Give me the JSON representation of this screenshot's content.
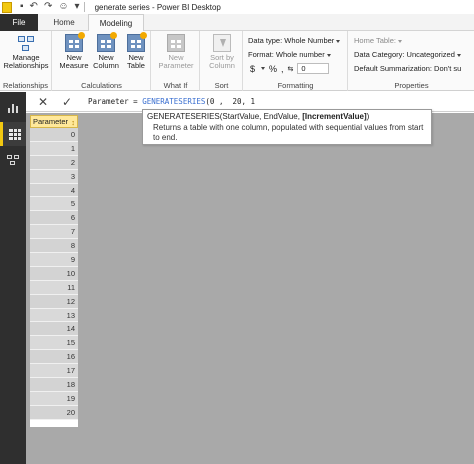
{
  "window": {
    "title": "generate series - Power BI Desktop"
  },
  "tabs": {
    "file": "File",
    "home": "Home",
    "modeling": "Modeling"
  },
  "ribbon": {
    "relationships": {
      "button": "Manage\nRelationships",
      "group": "Relationships"
    },
    "calculations": {
      "new_measure": "New\nMeasure",
      "new_column": "New\nColumn",
      "new_table": "New\nTable",
      "group": "Calculations"
    },
    "whatif": {
      "new_parameter": "New\nParameter",
      "group": "What If"
    },
    "sort": {
      "sort_by_column": "Sort by\nColumn",
      "group": "Sort"
    },
    "formatting": {
      "data_type": "Data type: Whole Number",
      "format": "Format: Whole number",
      "currency": "$",
      "percent": "%",
      "comma": ",",
      "decimals": "0",
      "group": "Formatting"
    },
    "properties": {
      "home_table": "Home Table:",
      "data_category": "Data Category: Uncategorized",
      "default_summarization": "Default Summarization: Don't su",
      "group": "Properties"
    }
  },
  "formula_bar": {
    "prefix": "Parameter = ",
    "function": "GENERATESERIES",
    "args": "(0 ,  20, 1"
  },
  "tooltip": {
    "signature_start": "GENERATESERIES(StartValue, EndValue, ",
    "signature_bold": "[IncrementValue]",
    "signature_end": ")",
    "description": "Returns a table with one column, populated with sequential values from start to end."
  },
  "table": {
    "column": "Parameter",
    "values": [
      "0",
      "1",
      "2",
      "3",
      "4",
      "5",
      "6",
      "7",
      "8",
      "9",
      "10",
      "11",
      "12",
      "13",
      "14",
      "15",
      "16",
      "17",
      "18",
      "19",
      "20"
    ]
  },
  "colors": {
    "accent": "#f2c811",
    "rail": "#2f2f2f",
    "function": "#3a6fd0"
  }
}
